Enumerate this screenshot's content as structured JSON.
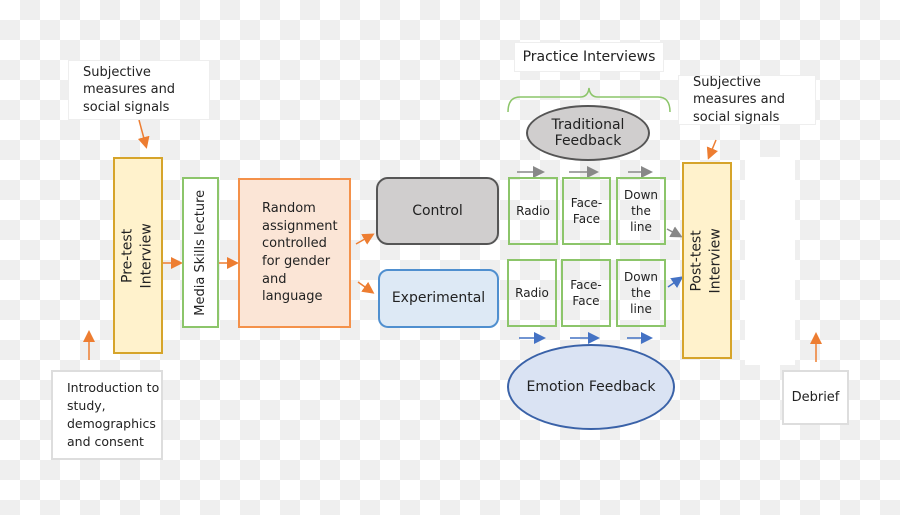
{
  "pre_callout": "Subjective measures and social signals",
  "post_callout": "Subjective measures and social signals",
  "pre_test": "Pre-test Interview",
  "media": "Media Skills lecture",
  "random": "Random assignment controlled for  gender and language",
  "control": "Control",
  "experimental": "Experimental",
  "practice": "Practice Interviews",
  "traditional": "Traditional Feedback",
  "emotion": "Emotion Feedback",
  "control_row": [
    "Radio",
    "Face-Face",
    "Down the line"
  ],
  "exp_row": [
    "Radio",
    "Face-Face",
    "Down the line"
  ],
  "post_test": "Post-test Interview",
  "intro": "Introduction to study, demographics and consent",
  "debrief": "Debrief",
  "colors": {
    "orange": "#f4914a",
    "green": "#8cc56a",
    "grey": "#555555",
    "blue": "#4472c4",
    "yellow_fill": "#fff2cc"
  }
}
